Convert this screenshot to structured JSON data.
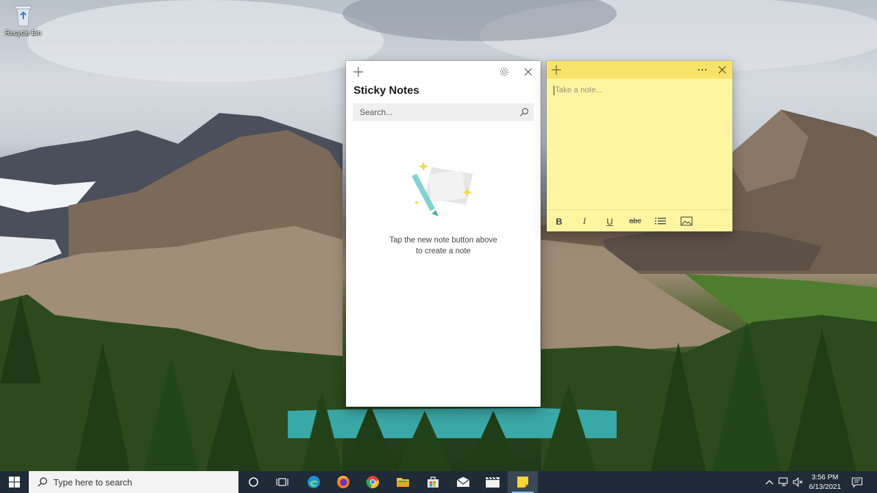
{
  "desktop": {
    "recycle_bin_label": "Recycle Bin"
  },
  "sticky_list": {
    "title": "Sticky Notes",
    "search_placeholder": "Search...",
    "empty_line1": "Tap the new note button above",
    "empty_line2": "to create a note",
    "icons": [
      "plus-icon",
      "gear-icon",
      "close-icon",
      "search-icon"
    ]
  },
  "note": {
    "placeholder": "Take a note...",
    "color": "#fff5a1",
    "header_color": "#f8e36a",
    "toolbar": {
      "bold": "B",
      "italic": "I",
      "underline": "U",
      "strikethrough": "abc"
    },
    "icons": [
      "plus-icon",
      "more-icon",
      "close-icon",
      "bullets-icon",
      "image-icon"
    ]
  },
  "taskbar": {
    "search_placeholder": "Type here to search",
    "apps": [
      "cortana",
      "task-view",
      "edge",
      "firefox",
      "chrome",
      "file-explorer",
      "store",
      "mail",
      "video-editor",
      "sticky-notes"
    ],
    "active_app": "sticky-notes",
    "clock_time": "3:56 PM",
    "clock_date": "6/13/2021"
  }
}
